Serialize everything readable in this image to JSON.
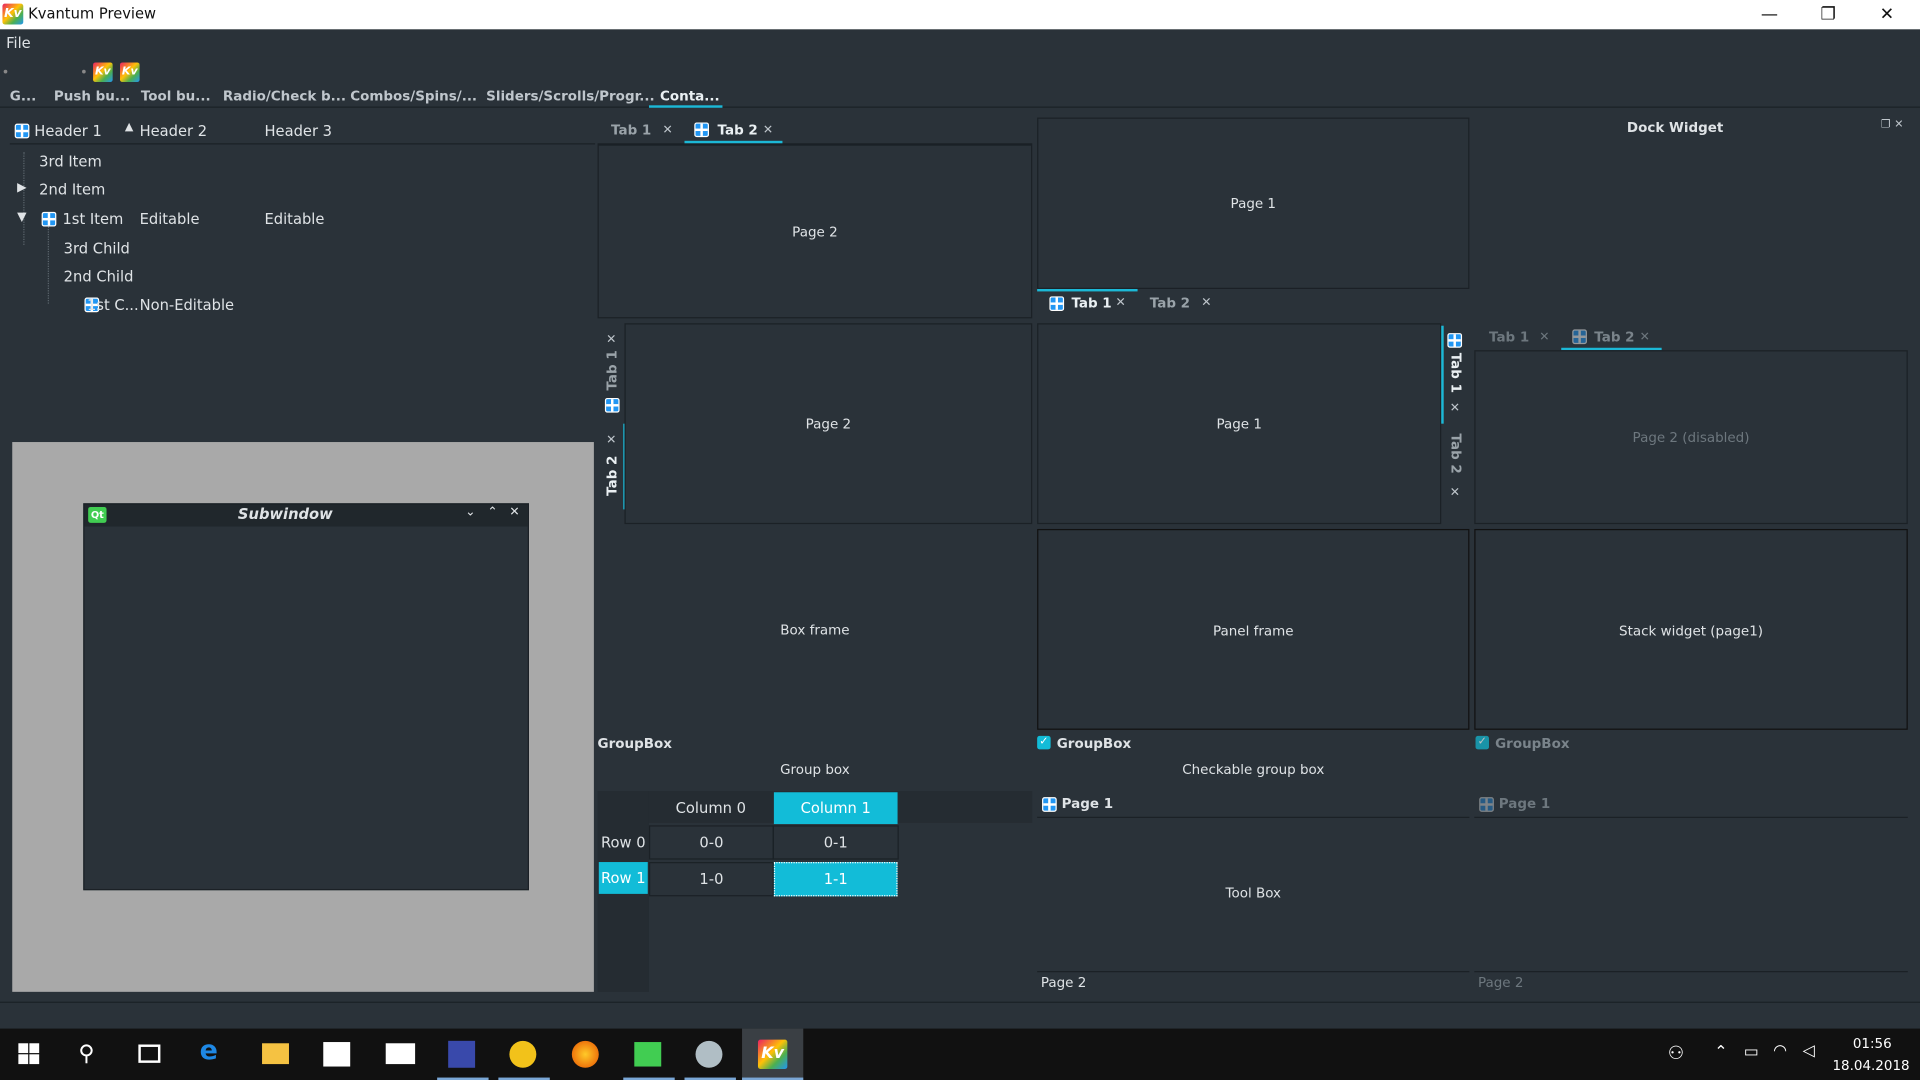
{
  "window": {
    "title": "Kvantum Preview",
    "minimize": "—",
    "maximize": "❐",
    "close": "✕"
  },
  "menu": {
    "file": "File"
  },
  "main_tabs": [
    "G...",
    "Push bu...",
    "Tool bu...",
    "Radio/Check b...",
    "Combos/Spins/...",
    "Sliders/Scrolls/Progr...",
    "Conta..."
  ],
  "tree": {
    "headers": [
      "Header 1",
      "Header 2",
      "Header 3"
    ],
    "rows": [
      {
        "c1": "3rd Item",
        "c2": "",
        "c3": ""
      },
      {
        "c1": "2nd Item",
        "c2": "",
        "c3": ""
      },
      {
        "c1": "1st Item",
        "c2": "Editable",
        "c3": "Editable"
      },
      {
        "c1": "3rd Child",
        "c2": "",
        "c3": ""
      },
      {
        "c1": "2nd Child",
        "c2": "",
        "c3": ""
      },
      {
        "c1": "1st C...",
        "c2": "Non-Editable",
        "c3": ""
      }
    ]
  },
  "subwindow": {
    "title": "Subwindow",
    "badge": "Qt"
  },
  "tabs_a": {
    "tab1": "Tab 1",
    "tab2": "Tab 2",
    "page": "Page 2"
  },
  "tabs_b": {
    "tab1": "Tab 1",
    "tab2": "Tab 2",
    "page": "Page 2"
  },
  "top_page1": "Page 1",
  "tabs_c": {
    "tab1": "Tab 1",
    "tab2": "Tab 2",
    "page": "Page 1"
  },
  "tabs_d": {
    "tab1": "Tab 1",
    "tab2": "Tab 2",
    "page": "Page 2 (disabled)"
  },
  "dock": {
    "title": "Dock Widget"
  },
  "frames": {
    "box": "Box frame",
    "panel": "Panel frame",
    "stack": "Stack widget (page1)"
  },
  "groups": {
    "g1_title": "GroupBox",
    "g1_body": "Group box",
    "g2_title": "GroupBox",
    "g2_body": "Checkable group box",
    "g3_title": "GroupBox"
  },
  "table": {
    "cols": [
      "Column 0",
      "Column 1"
    ],
    "rows": [
      "Row 0",
      "Row 1"
    ],
    "cells": [
      [
        "0-0",
        "0-1"
      ],
      [
        "1-0",
        "1-1"
      ]
    ]
  },
  "toolbox": {
    "page1": "Page 1",
    "page2": "Page 2",
    "body": "Tool Box"
  },
  "toolbox2": {
    "page1": "Page 1",
    "page2": "Page 2"
  },
  "clock": {
    "time": "01:56",
    "date": "18.04.2018"
  }
}
